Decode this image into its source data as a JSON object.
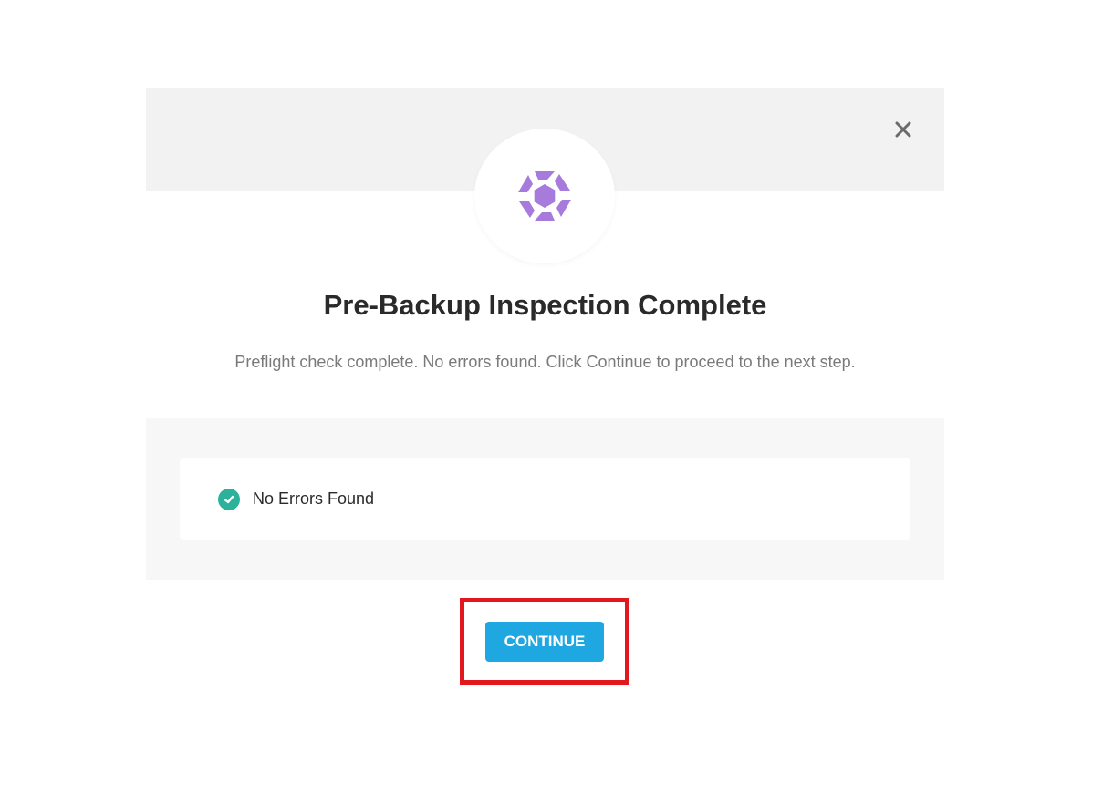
{
  "modal": {
    "title": "Pre-Backup Inspection Complete",
    "subtitle": "Preflight check complete. No errors found. Click Continue to proceed to the next step.",
    "close_icon": "close-icon",
    "logo_icon": "aperture-logo-icon",
    "result": {
      "icon": "check-circle-icon",
      "label": "No Errors Found"
    },
    "continue_label": "CONTINUE"
  },
  "colors": {
    "header_bg": "#f2f2f2",
    "panel_bg": "#f7f7f7",
    "logo_purple": "#a77bdc",
    "success_green": "#2ab39a",
    "button_blue": "#1ea7e1",
    "highlight_red": "#e3181f"
  }
}
